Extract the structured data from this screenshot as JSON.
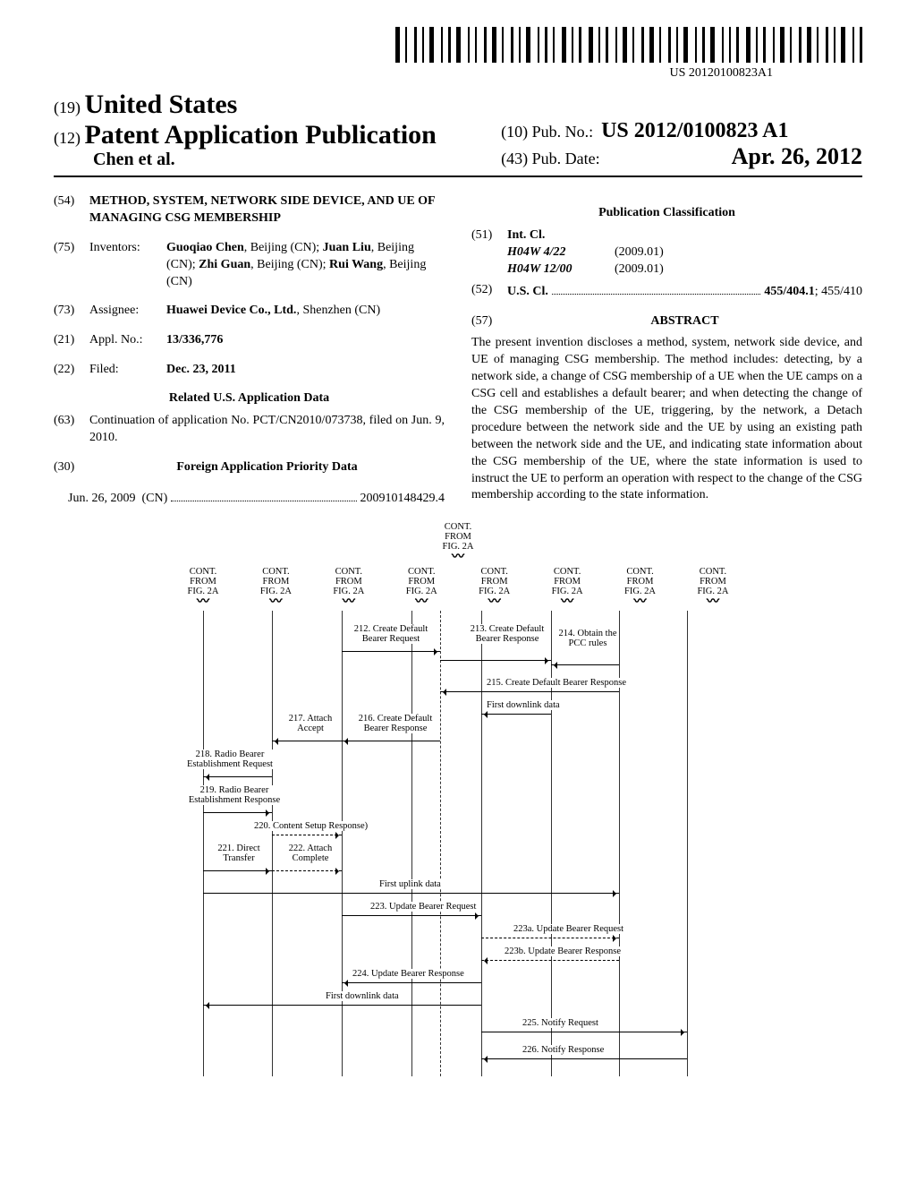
{
  "header": {
    "barcode_text": "US 20120100823A1",
    "country_prefix": "(19)",
    "country": "United States",
    "kind_prefix": "(12)",
    "kind": "Patent Application Publication",
    "authors": "Chen et al.",
    "pubno_prefix": "(10)",
    "pubno_label": "Pub. No.:",
    "pubno": "US 2012/0100823 A1",
    "pubdate_prefix": "(43)",
    "pubdate_label": "Pub. Date:",
    "pubdate": "Apr. 26, 2012"
  },
  "left": {
    "title_code": "(54)",
    "title": "METHOD, SYSTEM, NETWORK SIDE DEVICE, AND UE OF MANAGING CSG MEMBERSHIP",
    "inventors_code": "(75)",
    "inventors_label": "Inventors:",
    "inventors": "Guoqiao Chen, Beijing (CN); Juan Liu, Beijing (CN); Zhi Guan, Beijing (CN); Rui Wang, Beijing (CN)",
    "assignee_code": "(73)",
    "assignee_label": "Assignee:",
    "assignee": "Huawei Device Co., Ltd., Shenzhen (CN)",
    "applno_code": "(21)",
    "applno_label": "Appl. No.:",
    "applno": "13/336,776",
    "filed_code": "(22)",
    "filed_label": "Filed:",
    "filed": "Dec. 23, 2011",
    "related_heading": "Related U.S. Application Data",
    "continuation_code": "(63)",
    "continuation": "Continuation of application No. PCT/CN2010/073738, filed on Jun. 9, 2010.",
    "foreign_code": "(30)",
    "foreign_heading": "Foreign Application Priority Data",
    "foreign_date": "Jun. 26, 2009",
    "foreign_cc": "(CN)",
    "foreign_num": "200910148429.4"
  },
  "right": {
    "pubclass_heading": "Publication Classification",
    "intcl_code": "(51)",
    "intcl_label": "Int. Cl.",
    "intcl": [
      {
        "class": "H04W 4/22",
        "ver": "(2009.01)"
      },
      {
        "class": "H04W 12/00",
        "ver": "(2009.01)"
      }
    ],
    "uscl_code": "(52)",
    "uscl_label": "U.S. Cl.",
    "uscl_value": "455/404.1; 455/410",
    "abstract_code": "(57)",
    "abstract_label": "ABSTRACT",
    "abstract": "The present invention discloses a method, system, network side device, and UE of managing CSG membership. The method includes: detecting, by a network side, a change of CSG membership of a UE when the UE camps on a CSG cell and establishes a default bearer; and when detecting the change of the CSG membership of the UE, triggering, by the network, a Detach procedure between the network side and the UE by using an existing path between the network side and the UE, and indicating state information about the CSG membership of the UE, where the state information is used to instruct the UE to perform an operation with respect to the change of the CSG membership according to the state information."
  },
  "figure": {
    "cont_center": "CONT. FROM FIG. 2A",
    "cont": "CONT. FROM FIG. 2A",
    "messages": {
      "m212": "212. Create Default Bearer Request",
      "m213": "213. Create Default Bearer Response",
      "m214": "214. Obtain the PCC rules",
      "m215": "215. Create Default Bearer Response",
      "m216": "216. Create Default Bearer Response",
      "m217": "217. Attach Accept",
      "m218": "218. Radio Bearer Establishment Request",
      "m219": "219. Radio Bearer Establishment Response",
      "m220": "220. Content Setup Response)",
      "m221": "221. Direct Transfer",
      "m222": "222. Attach Complete",
      "first_dl": "First downlink data",
      "first_ul": "First uplink data",
      "m223": "223. Update Bearer Request",
      "m223a": "223a. Update Bearer Request",
      "m223b": "223b. Update Bearer Response",
      "m224": "224. Update Bearer Response",
      "first_dl2": "First downlink data",
      "m225": "225. Notify Request",
      "m226": "226. Notify Response"
    }
  }
}
